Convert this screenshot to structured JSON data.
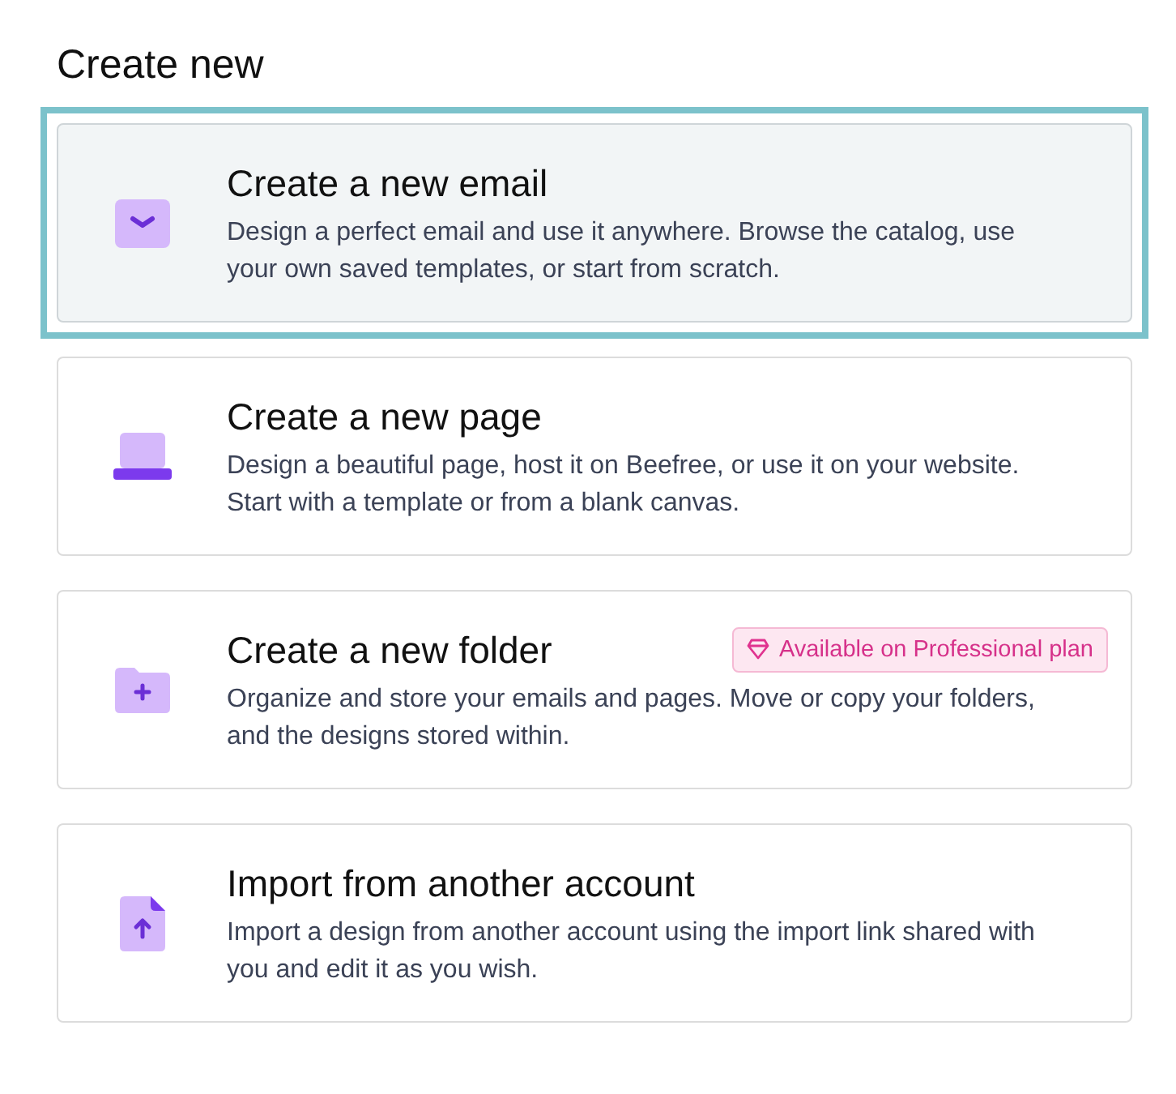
{
  "heading": "Create new",
  "options": [
    {
      "kind": "email",
      "title": "Create a new email",
      "description": "Design a perfect email and use it anywhere. Browse the catalog, use your own saved templates, or start from scratch.",
      "selected": true
    },
    {
      "kind": "page",
      "title": "Create a new page",
      "description": "Design a beautiful page, host it on Beefree, or use it on your website. Start with a template or from a blank canvas.",
      "selected": false
    },
    {
      "kind": "folder",
      "title": "Create a new folder",
      "description": "Organize and store your emails and pages. Move or copy your folders, and the designs stored within.",
      "selected": false,
      "badge": "Available on Professional plan"
    },
    {
      "kind": "import",
      "title": "Import from another account",
      "description": "Import a design from another account using the import link shared with you and edit it as you wish.",
      "selected": false
    }
  ]
}
